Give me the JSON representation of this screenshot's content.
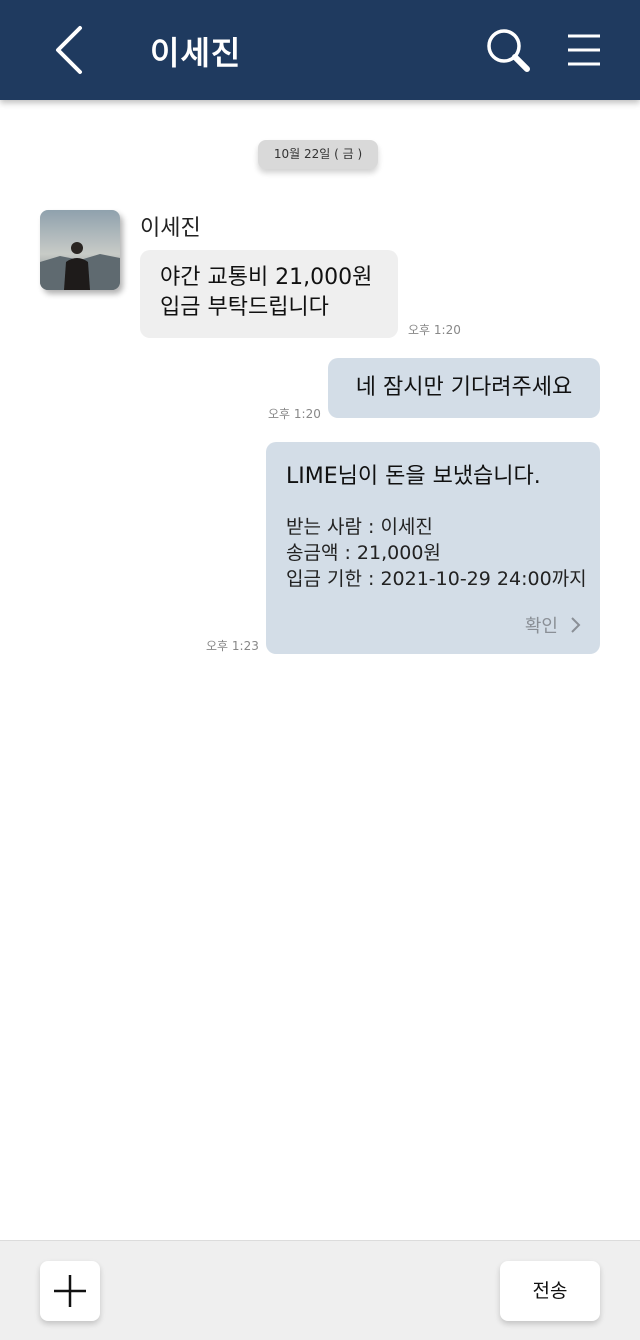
{
  "header": {
    "title": "이세진",
    "back_icon": "chevron-left-icon",
    "search_icon": "search-icon",
    "menu_icon": "hamburger-menu-icon",
    "background_color": "#1f3a5f"
  },
  "date_divider": "10월 22일 ( 금 )",
  "messages": {
    "incoming": {
      "sender": "이세진",
      "line1": "야간 교통비 21,000원",
      "line2": "입금 부탁드립니다",
      "time": "오후 1:20"
    },
    "outgoing": {
      "text": "네 잠시만 기다려주세요",
      "time": "오후 1:20"
    },
    "transfer_card": {
      "title": "LIME님이 돈을 보냈습니다.",
      "recipient": "받는 사람 : 이세진",
      "amount": "송금액 : 21,000원",
      "deadline": "입금 기한 : 2021-10-29 24:00까지",
      "confirm_label": "확인",
      "time": "오후 1:23"
    }
  },
  "bottom_bar": {
    "add_icon": "plus-icon",
    "send_label": "전송"
  }
}
